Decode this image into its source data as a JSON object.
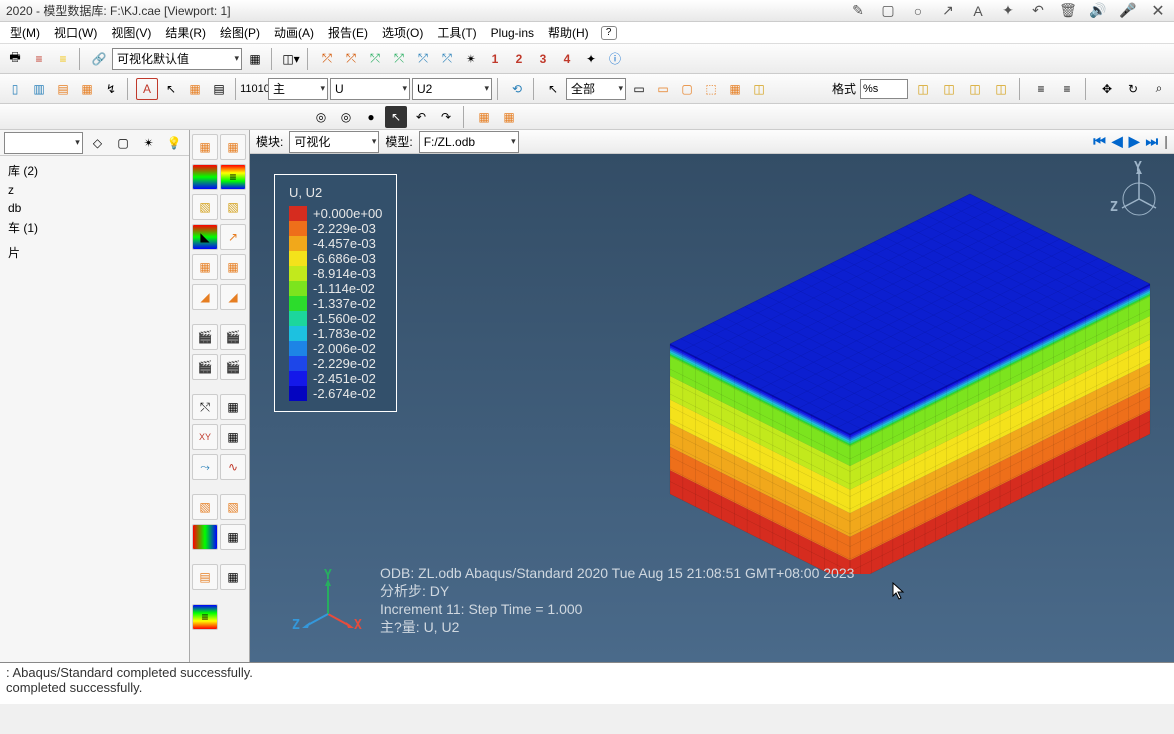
{
  "title": "2020 - 模型数据库: F:\\KJ.cae [Viewport: 1]",
  "menu": [
    "型(M)",
    "视口(W)",
    "视图(V)",
    "结果(R)",
    "绘图(P)",
    "动画(A)",
    "报告(E)",
    "选项(O)",
    "工具(T)",
    "Plug-ins",
    "帮助(H)"
  ],
  "vis_default": "可视化默认值",
  "primary_label": "主",
  "primary_var": "U",
  "primary_comp": "U2",
  "sel_scope": "全部",
  "format_label": "格式",
  "format_value": "%s",
  "module_label": "模块:",
  "module_value": "可视化",
  "model_label": "模型:",
  "model_value": "F:/ZL.odb",
  "tree": {
    "l1": "库 (2)",
    "l2": "z",
    "l3": "db",
    "l4": "车 (1)",
    "l5": "",
    "l6": "片"
  },
  "legend": {
    "title": "U, U2",
    "items": [
      {
        "color": "#d62c1f",
        "value": "+0.000e+00"
      },
      {
        "color": "#ee6f1a",
        "value": "-2.229e-03"
      },
      {
        "color": "#f1a81b",
        "value": "-4.457e-03"
      },
      {
        "color": "#f4e21b",
        "value": "-6.686e-03"
      },
      {
        "color": "#c2e91c",
        "value": "-8.914e-03"
      },
      {
        "color": "#7ce41e",
        "value": "-1.114e-02"
      },
      {
        "color": "#2cdc2c",
        "value": "-1.337e-02"
      },
      {
        "color": "#1cd69c",
        "value": "-1.560e-02"
      },
      {
        "color": "#1dc1e0",
        "value": "-1.783e-02"
      },
      {
        "color": "#1d84e6",
        "value": "-2.006e-02"
      },
      {
        "color": "#1d46e9",
        "value": "-2.229e-02"
      },
      {
        "color": "#1418ea",
        "value": "-2.451e-02"
      },
      {
        "color": "#0404c0",
        "value": "-2.674e-02"
      }
    ]
  },
  "info": {
    "line1": "ODB: ZL.odb    Abaqus/Standard 2020    Tue Aug 15 21:08:51 GMT+08:00 2023",
    "line2": "分析步: DY",
    "line3": "Increment    11: Step Time =   1.000",
    "line4": "主?量: U, U2"
  },
  "axes": {
    "x": "X",
    "y": "Y",
    "z": "Z"
  },
  "messages": {
    "m1": ": Abaqus/Standard completed successfully.",
    "m2": " completed successfully."
  },
  "csys_nums": [
    "1",
    "2",
    "3",
    "4"
  ]
}
